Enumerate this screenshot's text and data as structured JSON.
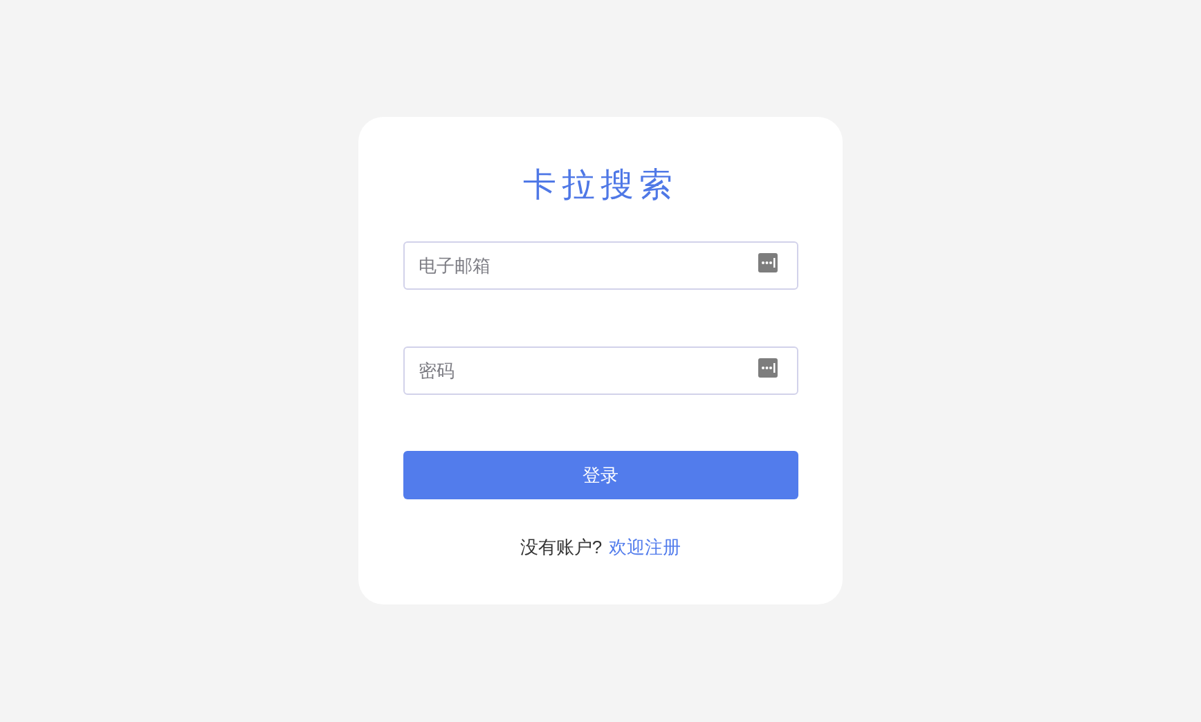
{
  "title": "卡拉搜索",
  "fields": [
    {
      "placeholder": "电子邮箱"
    },
    {
      "placeholder": "密码"
    }
  ],
  "login_button": "登录",
  "footer": {
    "text": "没有账户?",
    "link": "欢迎注册"
  }
}
